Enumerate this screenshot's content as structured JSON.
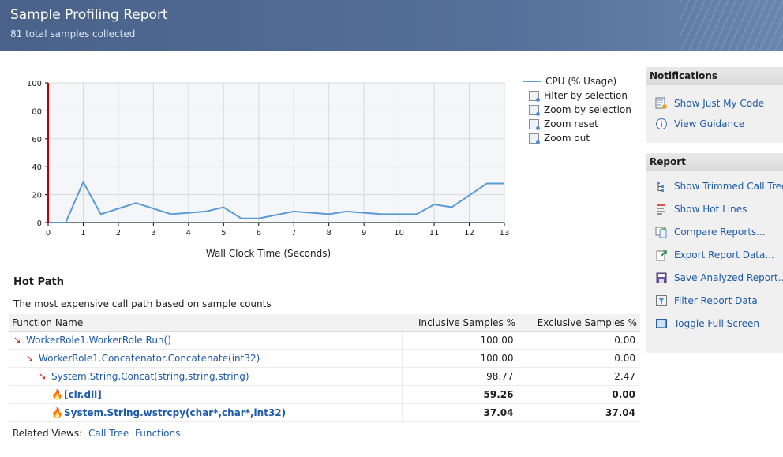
{
  "header": {
    "title": "Sample Profiling Report",
    "subtitle": "81 total samples collected"
  },
  "chart_data": {
    "type": "line",
    "title": "",
    "xlabel": "Wall Clock Time (Seconds)",
    "ylabel": "",
    "xlim": [
      0,
      13
    ],
    "ylim": [
      0,
      100
    ],
    "x_ticks": [
      "0",
      "1",
      "2",
      "3",
      "4",
      "5",
      "6",
      "7",
      "8",
      "9",
      "10",
      "11",
      "12",
      "13"
    ],
    "y_ticks": [
      "0",
      "20",
      "40",
      "60",
      "80",
      "100"
    ],
    "grid": true,
    "legend_position": "right",
    "series": [
      {
        "name": "CPU (% Usage)",
        "color": "#5b9bd5",
        "x": [
          0,
          0.5,
          1,
          1.5,
          2.5,
          3.5,
          4.5,
          5,
          5.5,
          6,
          7,
          8,
          8.5,
          9.5,
          10.5,
          11,
          11.5,
          12.5,
          13
        ],
        "y": [
          0,
          0,
          29,
          6,
          14,
          6,
          8,
          11,
          3,
          3,
          8,
          6,
          8,
          6,
          6,
          13,
          11,
          28,
          28
        ]
      }
    ],
    "marker": {
      "x": 0,
      "color": "#c00000"
    }
  },
  "legend": {
    "series_label": "CPU (% Usage)",
    "actions": [
      {
        "label": "Filter by selection",
        "icon": "filter-icon"
      },
      {
        "label": "Zoom by selection",
        "icon": "zoom-in-icon"
      },
      {
        "label": "Zoom reset",
        "icon": "zoom-reset-icon"
      },
      {
        "label": "Zoom out",
        "icon": "zoom-out-icon"
      }
    ]
  },
  "notifications": {
    "title": "Notifications",
    "links": [
      {
        "label": "Show Just My Code",
        "icon": "my-code-icon"
      },
      {
        "label": "View Guidance",
        "icon": "info-icon"
      }
    ]
  },
  "report": {
    "title": "Report",
    "links": [
      {
        "label": "Show Trimmed Call Tree",
        "icon": "call-tree-icon"
      },
      {
        "label": "Show Hot Lines",
        "icon": "hot-lines-icon"
      },
      {
        "label": "Compare Reports...",
        "icon": "compare-icon"
      },
      {
        "label": "Export Report Data...",
        "icon": "export-icon"
      },
      {
        "label": "Save Analyzed Report...",
        "icon": "save-icon"
      },
      {
        "label": "Filter Report Data",
        "icon": "filter-icon"
      },
      {
        "label": "Toggle Full Screen",
        "icon": "fullscreen-icon"
      }
    ]
  },
  "hot_path": {
    "title": "Hot Path",
    "description": "The most expensive call path based on sample counts",
    "columns": [
      "Function Name",
      "Inclusive Samples %",
      "Exclusive Samples %"
    ],
    "rows": [
      {
        "name": "WorkerRole1.WorkerRole.Run()",
        "inclusive": "100.00",
        "exclusive": "0.00",
        "icon": "hot-path-arrow-icon"
      },
      {
        "name": "WorkerRole1.Concatenator.Concatenate(int32)",
        "inclusive": "100.00",
        "exclusive": "0.00",
        "icon": "hot-path-arrow-icon"
      },
      {
        "name": "System.String.Concat(string,string,string)",
        "inclusive": "98.77",
        "exclusive": "2.47",
        "icon": "hot-path-arrow-icon"
      },
      {
        "name": "[clr.dll]",
        "inclusive": "59.26",
        "exclusive": "0.00",
        "icon": "hot-flame-icon"
      },
      {
        "name": "System.String.wstrcpy(char*,char*,int32)",
        "inclusive": "37.04",
        "exclusive": "37.04",
        "icon": "hot-flame-icon"
      }
    ]
  },
  "related_views": {
    "label": "Related Views:",
    "links": [
      "Call Tree",
      "Functions"
    ]
  }
}
